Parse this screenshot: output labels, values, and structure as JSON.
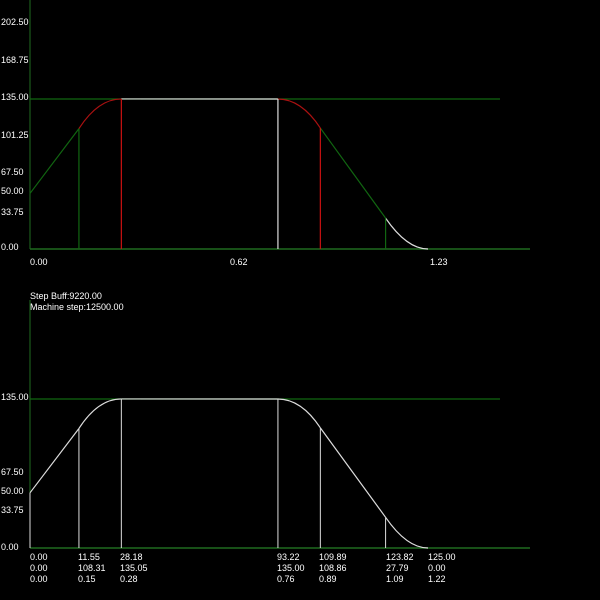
{
  "colors": {
    "background": "#000000",
    "axis": "#1f6b1f",
    "phase_line": "#116611",
    "accel_curve": "#aa1111",
    "marker_accel": "#cc1111",
    "marker_linear": "#116611",
    "profile": "#dddddd",
    "text": "#ffffff"
  },
  "status": {
    "step_buff": "Step Buff:9220.00",
    "machine_step": "Machine step:12500.00"
  },
  "chart_data": [
    {
      "type": "line",
      "title": "",
      "y_tick_labels": [
        "202.50",
        "168.75",
        "135.00",
        "101.25",
        "67.50",
        "50.00",
        "33.75",
        "0.00"
      ],
      "x_tick_labels": [
        "0.00",
        "0.62",
        "1.23"
      ],
      "ylim": [
        0,
        202.5
      ],
      "xlim": [
        0,
        1.23
      ],
      "max_level": 135.0,
      "series": [
        {
          "x": [
            0.0,
            0.15,
            0.28,
            0.76,
            0.89,
            1.09,
            1.22
          ],
          "y": [
            50.0,
            108.31,
            135.05,
            135.0,
            108.86,
            27.79,
            0.0
          ]
        }
      ],
      "markers": [
        0.15,
        0.28,
        0.76,
        0.89,
        1.09
      ]
    },
    {
      "type": "line",
      "title": "",
      "y_tick_labels": [
        "135.00",
        "67.50",
        "50.00",
        "33.75",
        "0.00"
      ],
      "ylim": [
        0,
        135
      ],
      "xlim": [
        0,
        1.23
      ],
      "max_level": 135.0,
      "series": [
        {
          "x": [
            0.0,
            0.15,
            0.28,
            0.76,
            0.89,
            1.09,
            1.22
          ],
          "y": [
            50.0,
            108.31,
            135.05,
            135.0,
            108.86,
            27.79,
            0.0
          ]
        }
      ],
      "breakpoints": [
        {
          "pos": "0.00",
          "speed": "0.00",
          "time": "0.00"
        },
        {
          "pos": "11.55",
          "speed": "108.31",
          "time": "0.15"
        },
        {
          "pos": "28.18",
          "speed": "135.05",
          "time": "0.28"
        },
        {
          "pos": "93.22",
          "speed": "135.00",
          "time": "0.76"
        },
        {
          "pos": "109.89",
          "speed": "108.86",
          "time": "0.89"
        },
        {
          "pos": "123.82",
          "speed": "27.79",
          "time": "1.09"
        },
        {
          "pos": "125.00",
          "speed": "0.00",
          "time": "1.22"
        }
      ]
    }
  ]
}
